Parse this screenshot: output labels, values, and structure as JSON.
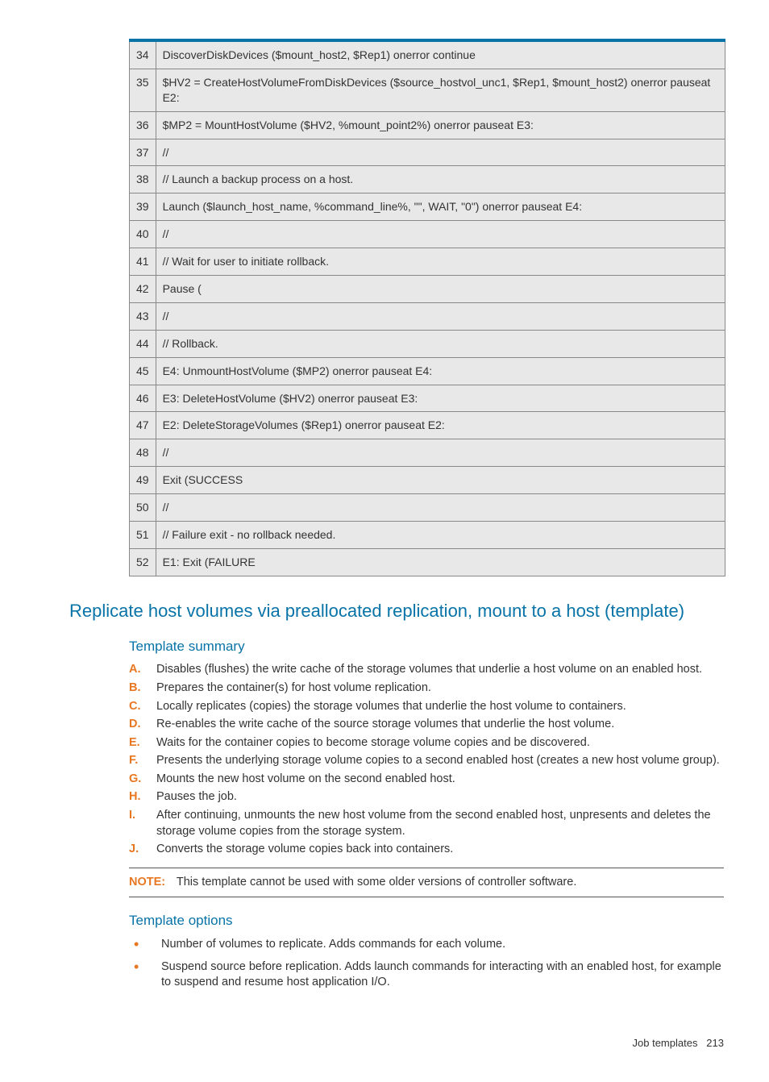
{
  "code_rows": [
    {
      "n": "34",
      "t": "DiscoverDiskDevices ($mount_host2, $Rep1) onerror continue"
    },
    {
      "n": "35",
      "t": "$HV2 = CreateHostVolumeFromDiskDevices ($source_hostvol_unc1, $Rep1, $mount_host2) onerror pauseat E2:"
    },
    {
      "n": "36",
      "t": "$MP2 = MountHostVolume ($HV2, %mount_point2%) onerror pauseat E3:"
    },
    {
      "n": "37",
      "t": "//"
    },
    {
      "n": "38",
      "t": "// Launch a backup process on a host."
    },
    {
      "n": "39",
      "t": "Launch ($launch_host_name, %command_line%, \"\", WAIT, \"0\") onerror pauseat E4:"
    },
    {
      "n": "40",
      "t": "//"
    },
    {
      "n": "41",
      "t": "// Wait for user to initiate rollback."
    },
    {
      "n": "42",
      "t": "Pause ("
    },
    {
      "n": "43",
      "t": "//"
    },
    {
      "n": "44",
      "t": "// Rollback."
    },
    {
      "n": "45",
      "t": "E4: UnmountHostVolume ($MP2) onerror pauseat E4:"
    },
    {
      "n": "46",
      "t": "E3: DeleteHostVolume ($HV2) onerror pauseat E3:"
    },
    {
      "n": "47",
      "t": "E2: DeleteStorageVolumes ($Rep1) onerror pauseat E2:"
    },
    {
      "n": "48",
      "t": "//"
    },
    {
      "n": "49",
      "t": "Exit (SUCCESS"
    },
    {
      "n": "50",
      "t": "//"
    },
    {
      "n": "51",
      "t": "// Failure exit - no rollback needed."
    },
    {
      "n": "52",
      "t": "E1: Exit (FAILURE"
    }
  ],
  "section_heading": "Replicate host volumes via preallocated replication, mount to a host (template)",
  "summary_heading": "Template summary",
  "summary_items": [
    {
      "l": "A.",
      "t": "Disables (flushes) the write cache of the storage volumes that underlie a host volume on an enabled host."
    },
    {
      "l": "B.",
      "t": "Prepares the container(s) for host volume replication."
    },
    {
      "l": "C.",
      "t": "Locally replicates (copies) the storage volumes that underlie the host volume to containers."
    },
    {
      "l": "D.",
      "t": "Re-enables the write cache of the source storage volumes that underlie the host volume."
    },
    {
      "l": "E.",
      "t": "Waits for the container copies to become storage volume copies and be discovered."
    },
    {
      "l": "F.",
      "t": "Presents the underlying storage volume copies to a second enabled host (creates a new host volume group)."
    },
    {
      "l": "G.",
      "t": "Mounts the new host volume on the second enabled host."
    },
    {
      "l": "H.",
      "t": "Pauses the job."
    },
    {
      "l": "I.",
      "t": "After continuing, unmounts the new host volume from the second enabled host, unpresents and deletes the storage volume copies from the storage system."
    },
    {
      "l": "J.",
      "t": "Converts the storage volume copies back into containers."
    }
  ],
  "note_label": "NOTE:",
  "note_text": "This template cannot be used with some older versions of controller software.",
  "options_heading": "Template options",
  "options_items": [
    "Number of volumes to replicate.  Adds commands for each volume.",
    "Suspend source before replication.  Adds launch commands for interacting with an enabled host, for example to suspend and resume host application I/O."
  ],
  "footer_label": "Job templates",
  "footer_page": "213"
}
